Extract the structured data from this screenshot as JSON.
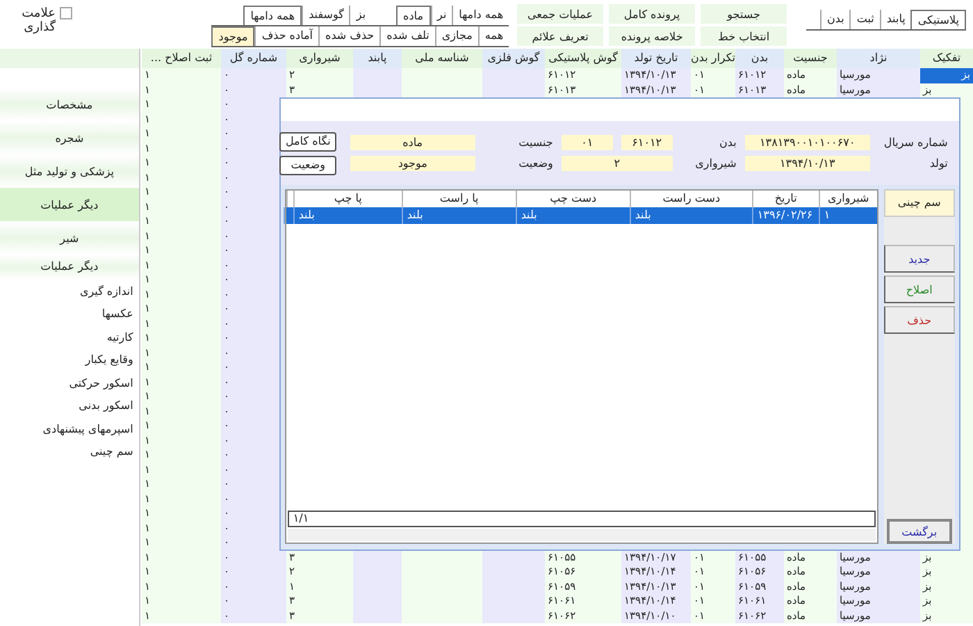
{
  "top_tabs": [
    {
      "label": "پلاستیکی",
      "selected": true
    },
    {
      "label": "پابند",
      "selected": false
    },
    {
      "label": "ثبت",
      "selected": false
    },
    {
      "label": "بدن",
      "selected": false
    }
  ],
  "actions": [
    "جستجو",
    "پرونده کامل",
    "عملیات جمعی",
    "انتخاب خط",
    "خلاصه پرونده",
    "تعریف علائم"
  ],
  "filters": {
    "sex": [
      {
        "label": "همه دامها",
        "selected": false
      },
      {
        "label": "نر",
        "selected": false
      },
      {
        "label": "ماده",
        "selected": true
      }
    ],
    "species": [
      {
        "label": "بز",
        "selected": false
      },
      {
        "label": "گوسفند",
        "selected": false
      },
      {
        "label": "همه دامها",
        "selected": true
      }
    ],
    "status": [
      {
        "label": "همه",
        "selected": false
      },
      {
        "label": "مجازی",
        "selected": false
      },
      {
        "label": "تلف شده",
        "selected": false
      },
      {
        "label": "حذف شده",
        "selected": false
      },
      {
        "label": "آماده حذف",
        "selected": false
      },
      {
        "label": "موجود",
        "selected": true
      }
    ]
  },
  "mark_checkbox": {
    "label": "علامت گذاری",
    "checked": false
  },
  "table": {
    "columns": [
      "تفکیک",
      "نژاد",
      "جنسیت",
      "بدن",
      "تکرار بدن",
      "تاریخ تولد",
      "گوش پلاستیکی",
      "گوش فلزی",
      "شناسه ملی",
      "پابند",
      "شیرواری",
      "شماره گل",
      "ثبت اصلاح ..."
    ],
    "rows_top": [
      {
        "cells": [
          "بز",
          "مورسیا",
          "ماده",
          "۶۱۰۱۲",
          "۰۱",
          "۱۳۹۴/۱۰/۱۳",
          "۶۱۰۱۲",
          null,
          null,
          null,
          "۲",
          "۰",
          "۱"
        ],
        "selected": true
      },
      {
        "cells": [
          "بز",
          "مورسیا",
          "ماده",
          "۶۱۰۱۳",
          "۰۱",
          "۱۳۹۴/۱۰/۱۳",
          "۶۱۰۱۳",
          null,
          null,
          null,
          "۳",
          "۰",
          "۱"
        ],
        "selected": false
      }
    ],
    "rows_under_dialog": [
      {
        "cells": [
          "۰",
          "۱"
        ]
      },
      {
        "cells": [
          "۰",
          "۱"
        ]
      },
      {
        "cells": [
          "۰",
          "۱"
        ]
      },
      {
        "cells": [
          "۰",
          "۱"
        ]
      },
      {
        "cells": [
          "۰",
          "۱"
        ]
      },
      {
        "cells": [
          "۰",
          "۱"
        ]
      },
      {
        "cells": [
          "۰",
          "۱"
        ]
      },
      {
        "cells": [
          "۰",
          "۱"
        ]
      },
      {
        "cells": [
          "۰",
          "۱"
        ]
      },
      {
        "cells": [
          "۰",
          "۱"
        ]
      },
      {
        "cells": [
          "۰",
          "۱"
        ]
      },
      {
        "cells": [
          "۰",
          "۱"
        ]
      },
      {
        "cells": [
          "۰",
          "۱"
        ]
      },
      {
        "cells": [
          "۰",
          "۱"
        ]
      },
      {
        "cells": [
          "۰",
          "۱"
        ]
      },
      {
        "cells": [
          "۰",
          "۱"
        ]
      },
      {
        "cells": [
          "۰",
          "۱"
        ]
      },
      {
        "cells": [
          "۰",
          "۱"
        ]
      },
      {
        "cells": [
          "۰",
          "۱"
        ]
      },
      {
        "cells": [
          "۰",
          "۱"
        ]
      },
      {
        "cells": [
          "۰",
          "۱"
        ]
      },
      {
        "cells": [
          "۰",
          "۱"
        ]
      },
      {
        "cells": [
          "۰",
          "۱"
        ]
      },
      {
        "cells": [
          "۰",
          "۱"
        ]
      },
      {
        "cells": [
          "۰",
          "۱"
        ]
      },
      {
        "cells": [
          "۰",
          "۱"
        ]
      },
      {
        "cells": [
          "۰",
          "۱"
        ]
      },
      {
        "cells": [
          "۰",
          "۱"
        ]
      },
      {
        "cells": [
          "۰",
          "۱"
        ]
      },
      {
        "cells": [
          "۰",
          "۱"
        ]
      },
      {
        "cells": [
          "۰",
          "۱"
        ]
      }
    ],
    "rows_bottom": [
      {
        "cells": [
          "بز",
          "مورسیا",
          "ماده",
          "۶۱۰۵۵",
          "۰۱",
          "۱۳۹۴/۱۰/۱۷",
          "۶۱۰۵۵",
          null,
          null,
          null,
          "۳",
          "۰",
          "۱"
        ],
        "selected": false
      },
      {
        "cells": [
          "بز",
          "مورسیا",
          "ماده",
          "۶۱۰۵۶",
          "۰۱",
          "۱۳۹۴/۱۰/۱۴",
          "۶۱۰۵۶",
          null,
          null,
          null,
          "۲",
          "۰",
          "۱"
        ],
        "selected": false
      },
      {
        "cells": [
          "بز",
          "مورسیا",
          "ماده",
          "۶۱۰۵۹",
          "۰۱",
          "۱۳۹۴/۱۰/۱۳",
          "۶۱۰۵۹",
          null,
          null,
          null,
          "۱",
          "۰",
          "۱"
        ],
        "selected": false
      },
      {
        "cells": [
          "بز",
          "مورسیا",
          "ماده",
          "۶۱۰۶۱",
          "۰۱",
          "۱۳۹۴/۱۰/۱۴",
          "۶۱۰۶۱",
          null,
          null,
          null,
          "۳",
          "۰",
          "۱"
        ],
        "selected": false
      },
      {
        "cells": [
          "بز",
          "مورسیا",
          "ماده",
          "۶۱۰۶۲",
          "۰۱",
          "۱۳۹۴/۱۰/۱۰",
          "۶۱۰۶۲",
          null,
          null,
          null,
          "۳",
          "۰",
          "۱"
        ],
        "selected": false
      }
    ]
  },
  "sidebar": {
    "sections": [
      {
        "label": "مشخصات",
        "selected": false
      },
      {
        "label": "شجره",
        "selected": false
      },
      {
        "label": "پزشکی و تولید مثل",
        "selected": false
      },
      {
        "label": "دیگر عملیات",
        "selected": true
      },
      {
        "label": "شیر",
        "selected": false
      }
    ],
    "list_title": "دیگر عملیات",
    "items": [
      "اندازه گیری",
      "عکسها",
      "کارتیه",
      "وقایع یکبار",
      "اسکور حرکتی",
      "اسکور بدنی",
      "اسپرمهای پیشنهادی",
      "سم چینی"
    ]
  },
  "dialog": {
    "fields": [
      {
        "label": "شماره سریال",
        "values": [
          "۱۳۸۱۳۹۰۰۱۰۱۰۰۶۷۰"
        ]
      },
      {
        "label": "بدن",
        "values": [
          "۶۱۰۱۲",
          "۰۱"
        ]
      },
      {
        "label": "جنسیت",
        "values": [
          "ماده"
        ]
      },
      {
        "label": "تولد",
        "values": [
          "۱۳۹۴/۱۰/۱۳"
        ]
      },
      {
        "label": "شیرواری",
        "values": [
          "۲"
        ]
      },
      {
        "label": "وضعیت",
        "values": [
          "موجود"
        ]
      }
    ],
    "buttons": [
      "نگاه کامل",
      "وضعیت"
    ],
    "grid": {
      "columns": [
        "شیرواری",
        "تاریخ",
        "دست راست",
        "دست چپ",
        "پا راست",
        "پا چپ"
      ],
      "rows": [
        {
          "cells": [
            "۱",
            "۱۳۹۶/۰۲/۲۶",
            "بلند",
            "بلند",
            "بلند",
            "بلند"
          ],
          "selected": true
        }
      ],
      "pager": "۱/۱"
    },
    "tab": "سم چینی",
    "side_buttons": [
      {
        "label": "جدید",
        "color": "#2a2aa8"
      },
      {
        "label": "اصلاح",
        "color": "#2a8a2a"
      },
      {
        "label": "حذف",
        "color": "#c02a2a"
      }
    ],
    "back_button": "برگشت"
  }
}
